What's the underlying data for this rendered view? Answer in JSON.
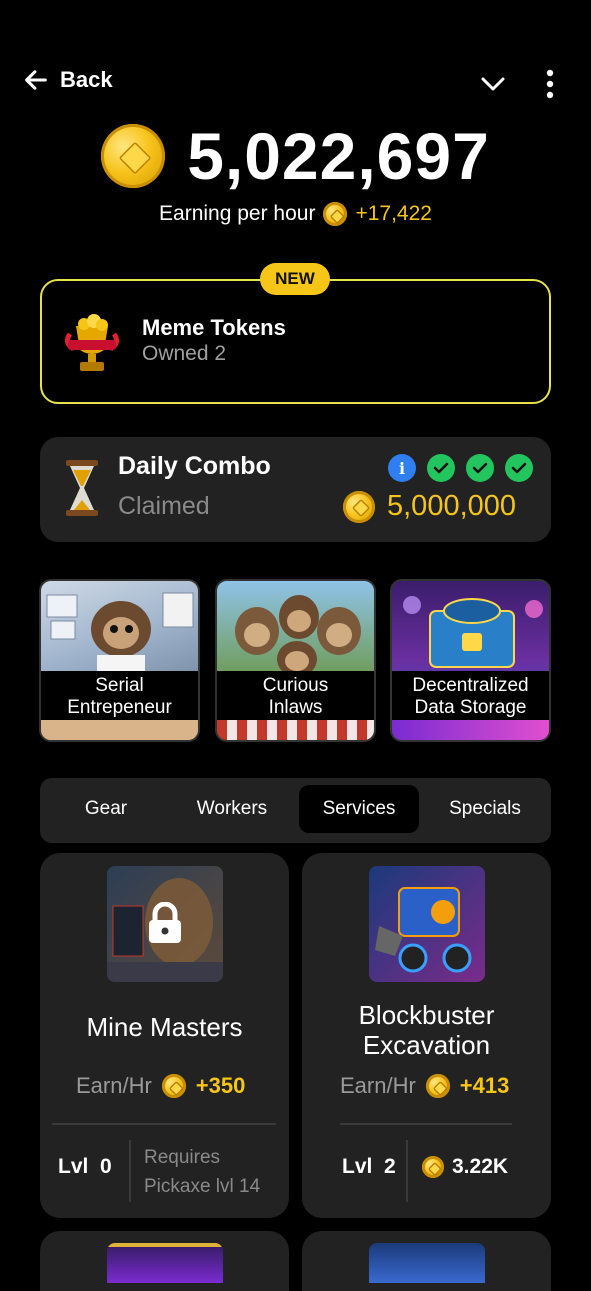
{
  "header": {
    "back_label": "Back"
  },
  "balance": {
    "value": "5,022,697",
    "earning_label": "Earning per hour",
    "earning_value": "+17,422"
  },
  "new_card": {
    "badge": "NEW",
    "title": "Meme Tokens",
    "subtitle": "Owned 2"
  },
  "daily_combo": {
    "title": "Daily Combo",
    "status": "Claimed",
    "reward": "5,000,000",
    "info": "i"
  },
  "promo_cards": [
    {
      "line1": "Serial",
      "line2": "Entrepeneur"
    },
    {
      "line1": "Curious",
      "line2": "Inlaws"
    },
    {
      "line1": "Decentralized",
      "line2": "Data Storage"
    }
  ],
  "tabs": [
    {
      "label": "Gear"
    },
    {
      "label": "Workers"
    },
    {
      "label": "Services"
    },
    {
      "label": "Specials"
    }
  ],
  "upgrades": [
    {
      "name": "Mine Masters",
      "earn_label": "Earn/Hr",
      "earn_value": "+350",
      "level": "Lvl  0",
      "requires_line1": "Requires",
      "requires_line2": "Pickaxe lvl 14"
    },
    {
      "name_line1": "Blockbuster",
      "name_line2": "Excavation",
      "earn_label": "Earn/Hr",
      "earn_value": "+413",
      "level": "Lvl  2",
      "cost": "3.22K"
    }
  ],
  "colors": {
    "accent": "#f5c518",
    "card": "#222222",
    "active_tab": "#000000",
    "check": "#22c55e",
    "info": "#2f7ff0"
  }
}
